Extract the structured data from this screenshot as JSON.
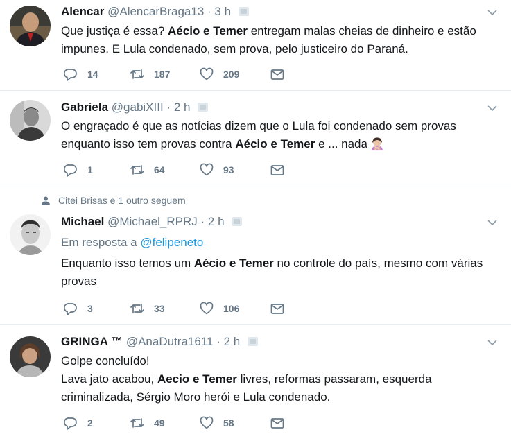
{
  "timestamp_dot": "·",
  "tweets": [
    {
      "name": "Alencar",
      "handle": "@AlencarBraga13",
      "time": "3 h",
      "text": [
        {
          "t": "Que justiça é essa? ",
          "b": false
        },
        {
          "t": "Aécio e Temer",
          "b": true
        },
        {
          "t": " entregam malas cheias de dinheiro e estão impunes. E Lula condenado, sem prova, pelo justiceiro do Paraná.",
          "b": false
        }
      ],
      "replies": "14",
      "retweets": "187",
      "likes": "209"
    },
    {
      "name": "Gabriela",
      "handle": "@gabiXIII",
      "time": "2 h",
      "text": [
        {
          "t": "O engraçado é que as notícias dizem que o Lula foi condenado sem provas enquanto isso tem provas contra ",
          "b": false
        },
        {
          "t": "Aécio e Temer",
          "b": true
        },
        {
          "t": " e ... nada",
          "b": false
        }
      ],
      "replies": "1",
      "retweets": "64",
      "likes": "93"
    },
    {
      "social_context": "Citei Brisas e 1 outro seguem",
      "name": "Michael",
      "handle": "@Michael_RPRJ",
      "time": "2 h",
      "reply_prefix": "Em resposta a",
      "reply_to": "@felipeneto",
      "text": [
        {
          "t": "Enquanto isso temos um ",
          "b": false
        },
        {
          "t": "Aécio e Temer",
          "b": true
        },
        {
          "t": " no controle do país, mesmo com várias provas",
          "b": false
        }
      ],
      "replies": "3",
      "retweets": "33",
      "likes": "106"
    },
    {
      "name": "GRINGA ™",
      "handle": "@AnaDutra1611",
      "time": "2 h",
      "text": [
        {
          "t": "Golpe concluído!\nLava jato acabou, ",
          "b": false
        },
        {
          "t": "Aecio e Temer",
          "b": true
        },
        {
          "t": " livres, reformas passaram, esquerda criminalizada, Sérgio Moro herói e Lula condenado.",
          "b": false
        }
      ],
      "replies": "2",
      "retweets": "49",
      "likes": "58"
    }
  ],
  "icons": {
    "reply": "reply-icon",
    "retweet": "retweet-icon",
    "like": "heart-icon",
    "dm": "envelope-icon",
    "caret": "chevron-down-icon",
    "social": "person-icon"
  },
  "colors": {
    "text": "#14171a",
    "muted": "#657786",
    "link": "#1b95e0",
    "divider": "#e6ecf0"
  }
}
